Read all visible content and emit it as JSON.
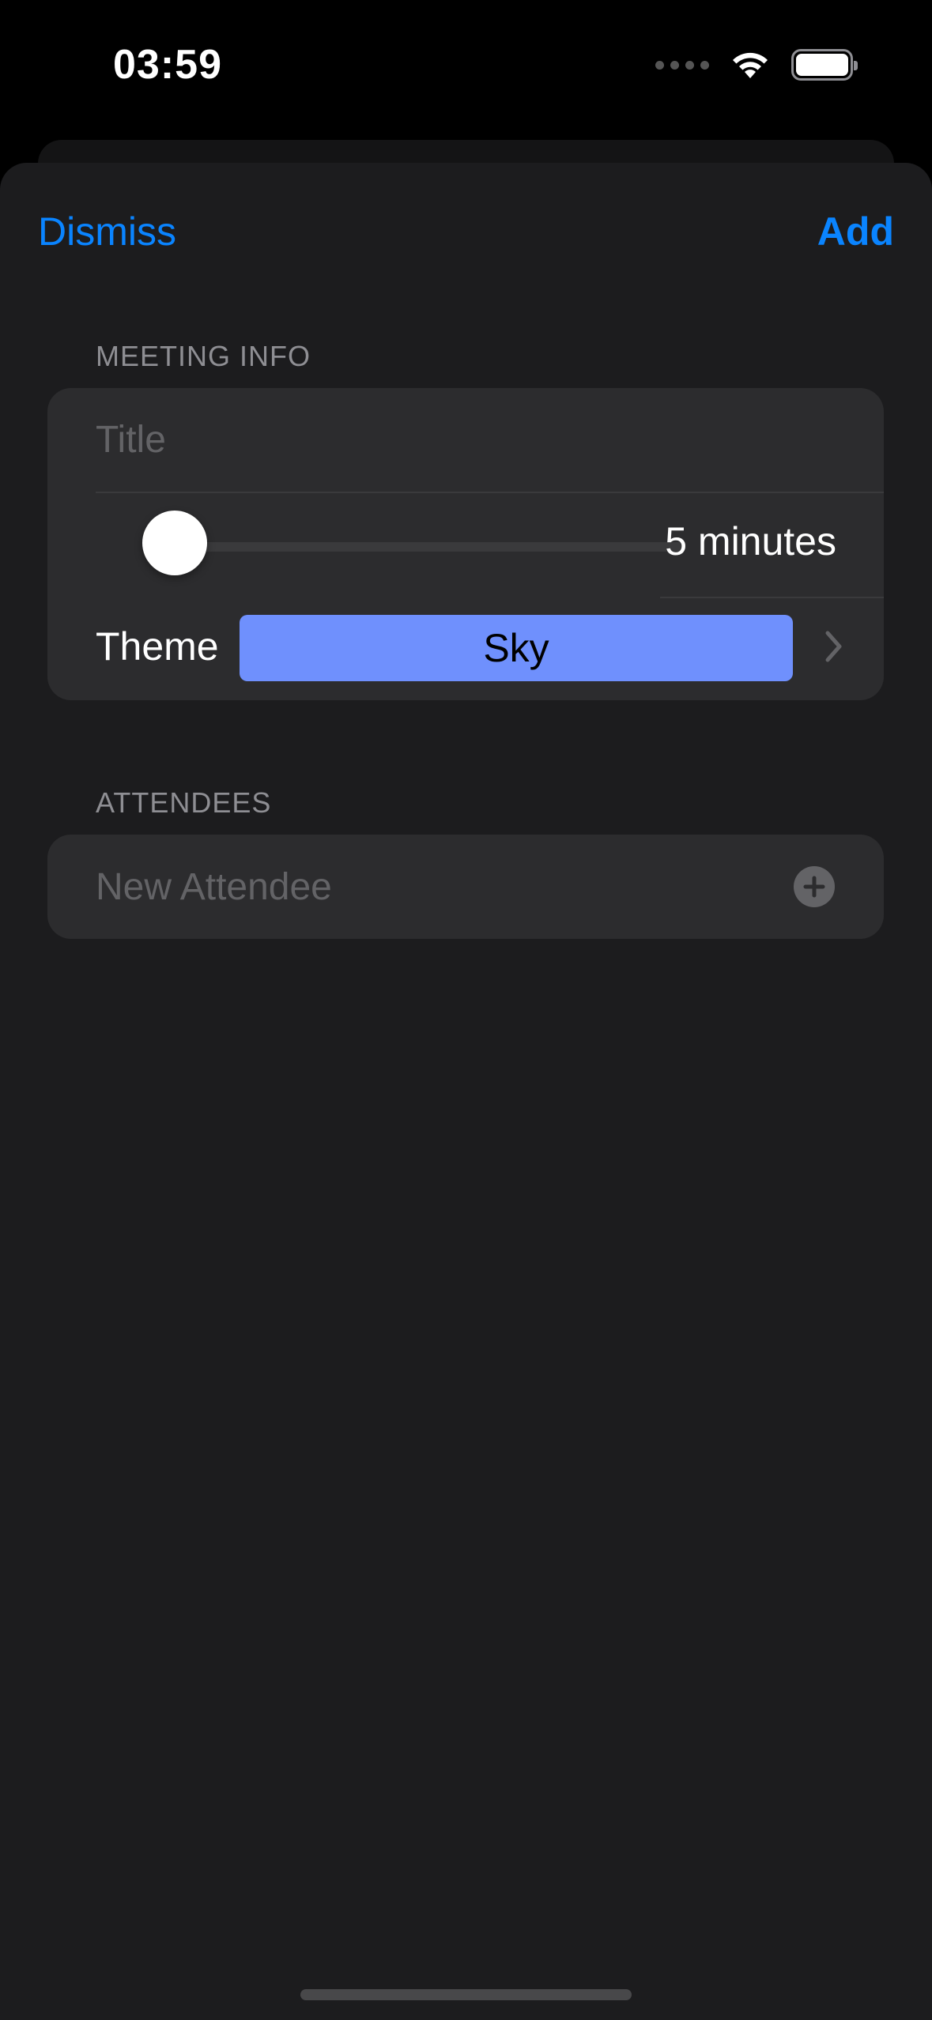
{
  "status_bar": {
    "time": "03:59"
  },
  "nav": {
    "dismiss_label": "Dismiss",
    "add_label": "Add"
  },
  "meeting_info": {
    "header": "MEETING INFO",
    "title_placeholder": "Title",
    "title_value": "",
    "duration_label": "5 minutes",
    "duration_slider_fraction": 0.0,
    "theme_label": "Theme",
    "theme_value": "Sky",
    "theme_color": "#6f90fd"
  },
  "attendees": {
    "header": "ATTENDEES",
    "new_attendee_placeholder": "New Attendee"
  },
  "colors": {
    "accent": "#0a84ff",
    "background": "#1c1c1e",
    "group": "#2c2c2e"
  },
  "icons": {
    "wifi": "wifi-icon",
    "battery": "battery-icon",
    "chevron": "chevron-right-icon",
    "add": "plus-circle-icon"
  }
}
